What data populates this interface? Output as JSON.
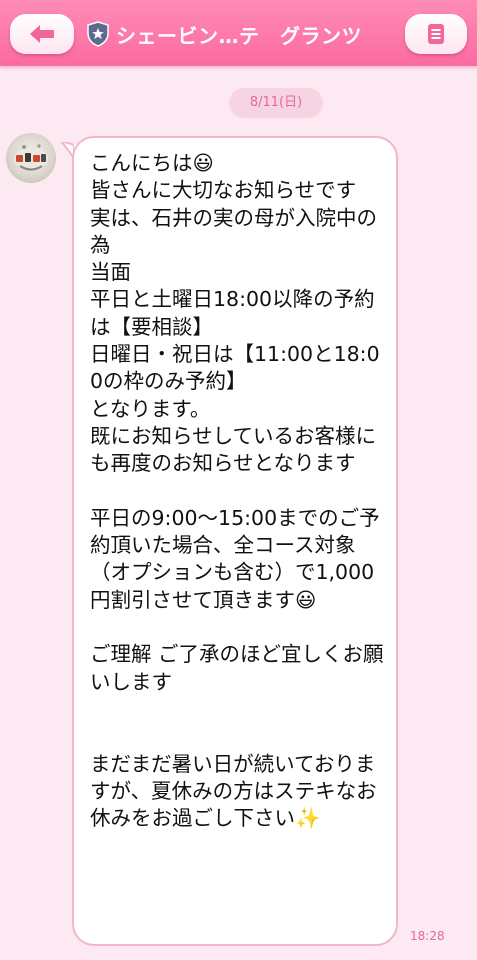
{
  "header": {
    "title": "シェービン…テ　グランツ",
    "back_icon": "arrow-left-icon",
    "menu_icon": "memo-icon",
    "badge_icon": "shield-star-icon"
  },
  "date_label": "8/11(日)",
  "message": {
    "text": "こんにちは😃\n皆さんに大切なお知らせです\n実は、石井の実の母が入院中の為\n当面\n平日と土曜日18:00以降の予約は【要相談】\n日曜日・祝日は【11:00と18:00の枠のみ予約】\nとなります。\n既にお知らせしているお客様にも再度のお知らせとなります\n\n平日の9:00〜15:00までのご予約頂いた場合、全コース対象（オプションも含む）で1,000円割引させて頂きます😃\n\nご理解 ご了承のほど宜しくお願いします\n\n\nまだまだ暑い日が続いておりますが、夏休みの方はステキなお休みをお過ごし下さい✨",
    "time": "18:28"
  },
  "colors": {
    "header": "#fb6aa0",
    "background": "#fde9f1",
    "bubble_border": "#f3b5cd",
    "accent_text": "#e46a9b"
  }
}
